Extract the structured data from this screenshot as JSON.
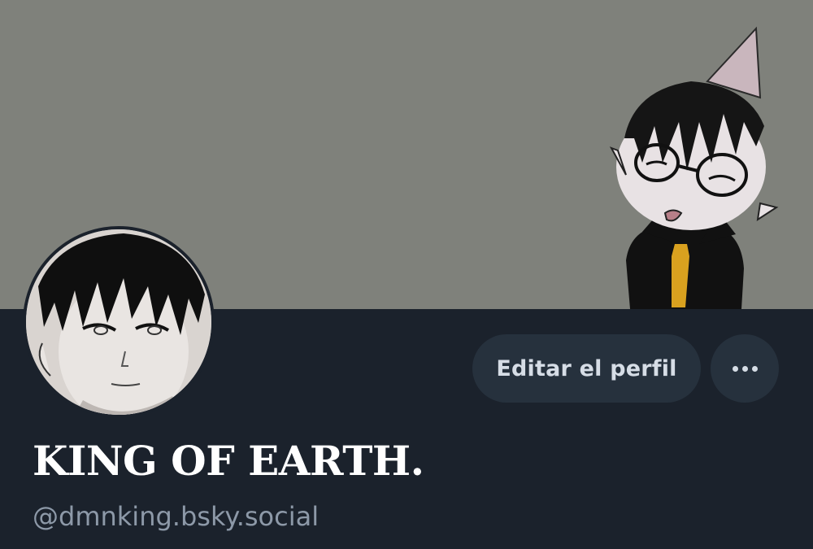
{
  "banner": {
    "background_color": "#7f817b",
    "image_description_icon": "chibi-character-banner-image"
  },
  "avatar": {
    "icon": "anime-character-avatar-image"
  },
  "actions": {
    "edit_profile_label": "Editar el perfil",
    "more_icon": "ellipsis-icon"
  },
  "profile": {
    "display_name": "KING OF EARTH.",
    "handle": "@dmnking.bsky.social"
  },
  "colors": {
    "page_background": "#1b222c",
    "button_background": "#26313d",
    "button_text": "#d6dde6",
    "name_text": "#ffffff",
    "handle_text": "#8d99a8"
  }
}
